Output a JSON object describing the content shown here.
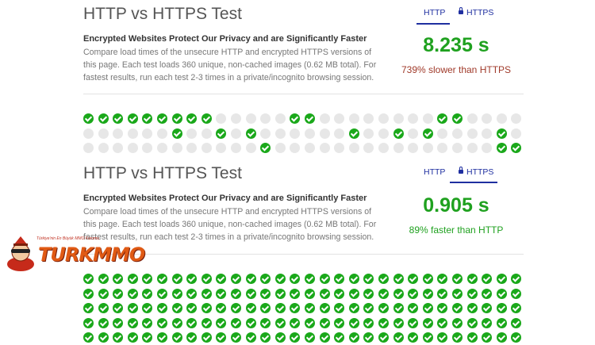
{
  "panels": [
    {
      "title": "HTTP vs HTTPS Test",
      "subtitle": "Encrypted Websites Protect Our Privacy and are Significantly Faster",
      "description": "Compare load times of the unsecure HTTP and encrypted HTTPS versions of this page. Each test loads 360 unique, non-cached images (0.62 MB total). For fastest results, run each test 2-3 times in a private/incognito browsing session.",
      "tabs": {
        "http_label": "HTTP",
        "https_label": "HTTPS",
        "active": "HTTP"
      },
      "result_time": "8.235 s",
      "comparison": "739% slower than HTTPS",
      "grid": {
        "rows": [
          [
            1,
            1,
            1,
            1,
            1,
            1,
            1,
            1,
            1,
            0,
            0,
            0,
            0,
            0,
            1,
            1,
            0,
            0,
            0,
            0,
            0,
            0,
            0,
            0,
            1,
            1,
            0,
            0,
            0,
            0
          ],
          [
            0,
            0,
            0,
            0,
            0,
            0,
            1,
            0,
            0,
            1,
            0,
            1,
            0,
            0,
            0,
            0,
            0,
            0,
            1,
            0,
            0,
            1,
            0,
            1,
            0,
            0,
            0,
            0,
            1,
            0
          ],
          [
            0,
            0,
            0,
            0,
            0,
            0,
            0,
            0,
            0,
            0,
            0,
            0,
            1,
            0,
            0,
            0,
            0,
            0,
            0,
            0,
            0,
            0,
            0,
            0,
            0,
            0,
            0,
            0,
            1,
            1
          ]
        ]
      }
    },
    {
      "title": "HTTP vs HTTPS Test",
      "subtitle": "Encrypted Websites Protect Our Privacy and are Significantly Faster",
      "description": "Compare load times of the unsecure HTTP and encrypted HTTPS versions of this page. Each test loads 360 unique, non-cached images (0.62 MB total). For fastest results, run each test 2-3 times in a private/incognito browsing session.",
      "tabs": {
        "http_label": "HTTP",
        "https_label": "HTTPS",
        "active": "HTTPS"
      },
      "result_time": "0.905 s",
      "comparison": "89% faster than HTTP",
      "grid": {
        "rows": [
          [
            1,
            1,
            1,
            1,
            1,
            1,
            1,
            1,
            1,
            1,
            1,
            1,
            1,
            1,
            1,
            1,
            1,
            1,
            1,
            1,
            1,
            1,
            1,
            1,
            1,
            1,
            1,
            1,
            1,
            1
          ],
          [
            1,
            1,
            1,
            1,
            1,
            1,
            1,
            1,
            1,
            1,
            1,
            1,
            1,
            1,
            1,
            1,
            1,
            1,
            1,
            1,
            1,
            1,
            1,
            1,
            1,
            1,
            1,
            1,
            1,
            1
          ],
          [
            1,
            1,
            1,
            1,
            1,
            1,
            1,
            1,
            1,
            1,
            1,
            1,
            1,
            1,
            1,
            1,
            1,
            1,
            1,
            1,
            1,
            1,
            1,
            1,
            1,
            1,
            1,
            1,
            1,
            1
          ],
          [
            1,
            1,
            1,
            1,
            1,
            1,
            1,
            1,
            1,
            1,
            1,
            1,
            1,
            1,
            1,
            1,
            1,
            1,
            1,
            1,
            1,
            1,
            1,
            1,
            1,
            1,
            1,
            1,
            1,
            1
          ],
          [
            1,
            1,
            1,
            1,
            1,
            1,
            1,
            1,
            1,
            1,
            1,
            1,
            1,
            1,
            1,
            1,
            1,
            1,
            1,
            1,
            1,
            1,
            1,
            1,
            1,
            1,
            1,
            1,
            1,
            1
          ]
        ]
      }
    }
  ],
  "watermark": {
    "brand": "TURKMMO",
    "tagline": "Türkiye'nin En Büyük MMO Forumu"
  }
}
